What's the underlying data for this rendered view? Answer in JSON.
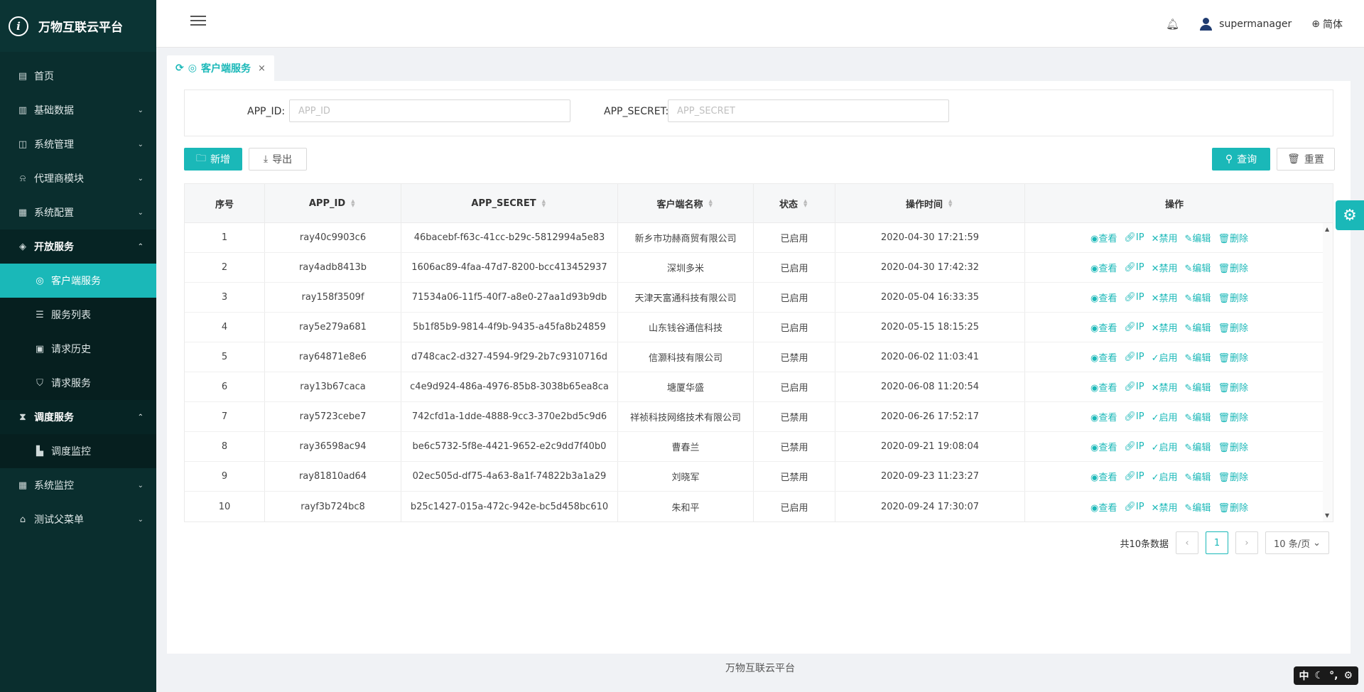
{
  "app": {
    "title": "万物互联云平台"
  },
  "sidebar": {
    "items": [
      {
        "icon": "calendar-icon",
        "glyph": "▤",
        "label": "首页"
      },
      {
        "icon": "barcode-icon",
        "glyph": "▥",
        "label": "基础数据",
        "arrow": "⌄"
      },
      {
        "icon": "camera-icon",
        "glyph": "◫",
        "label": "系统管理",
        "arrow": "⌄"
      },
      {
        "icon": "bell-icon",
        "glyph": "⍾",
        "label": "代理商模块",
        "arrow": "⌄"
      },
      {
        "icon": "config-icon",
        "glyph": "▦",
        "label": "系统配置",
        "arrow": "⌄"
      },
      {
        "icon": "tag-icon",
        "glyph": "◈",
        "label": "开放服务",
        "arrow": "⌃",
        "open": true,
        "children": [
          {
            "icon": "target-icon",
            "glyph": "◎",
            "label": "客户端服务",
            "active": true
          },
          {
            "icon": "list-icon",
            "glyph": "☰",
            "label": "服务列表"
          },
          {
            "icon": "archive-icon",
            "glyph": "▣",
            "label": "请求历史"
          },
          {
            "icon": "shield-icon",
            "glyph": "⛉",
            "label": "请求服务"
          }
        ]
      },
      {
        "icon": "hourglass-icon",
        "glyph": "⧗",
        "label": "调度服务",
        "arrow": "⌃",
        "open": true,
        "children": [
          {
            "icon": "chart-icon",
            "glyph": "▙",
            "label": "调度监控"
          }
        ]
      },
      {
        "icon": "monitor-icon",
        "glyph": "▦",
        "label": "系统监控",
        "arrow": "⌄"
      },
      {
        "icon": "bank-icon",
        "glyph": "⌂",
        "label": "测试父菜单",
        "arrow": "⌄"
      }
    ]
  },
  "header": {
    "username": "supermanager",
    "language": "简体"
  },
  "tabs": [
    {
      "label": "客户端服务",
      "close": "×"
    }
  ],
  "search": {
    "app_id_label": "APP_ID:",
    "app_id_placeholder": "APP_ID",
    "app_id_value": "",
    "app_secret_label": "APP_SECRET:",
    "app_secret_placeholder": "APP_SECRET",
    "app_secret_value": ""
  },
  "toolbar": {
    "add_label": "新增",
    "export_label": "导出",
    "query_label": "查询",
    "reset_label": "重置"
  },
  "table": {
    "columns": [
      "序号",
      "APP_ID",
      "APP_SECRET",
      "客户端名称",
      "状态",
      "操作时间",
      "操作"
    ],
    "rows": [
      {
        "no": "1",
        "app_id": "ray40c9903c6",
        "secret": "46bacebf-f63c-41cc-b29c-5812994a5e83",
        "name": "新乡市功赫商贸有限公司",
        "status": "已启用",
        "time": "2020-04-30 17:21:59",
        "toggle": "禁用"
      },
      {
        "no": "2",
        "app_id": "ray4adb8413b",
        "secret": "1606ac89-4faa-47d7-8200-bcc413452937",
        "name": "深圳多米",
        "status": "已启用",
        "time": "2020-04-30 17:42:32",
        "toggle": "禁用"
      },
      {
        "no": "3",
        "app_id": "ray158f3509f",
        "secret": "71534a06-11f5-40f7-a8e0-27aa1d93b9db",
        "name": "天津天富通科技有限公司",
        "status": "已启用",
        "time": "2020-05-04 16:33:35",
        "toggle": "禁用"
      },
      {
        "no": "4",
        "app_id": "ray5e279a681",
        "secret": "5b1f85b9-9814-4f9b-9435-a45fa8b24859",
        "name": "山东钱谷通信科技",
        "status": "已启用",
        "time": "2020-05-15 18:15:25",
        "toggle": "禁用"
      },
      {
        "no": "5",
        "app_id": "ray64871e8e6",
        "secret": "d748cac2-d327-4594-9f29-2b7c9310716d",
        "name": "信灏科技有限公司",
        "status": "已禁用",
        "time": "2020-06-02 11:03:41",
        "toggle": "启用"
      },
      {
        "no": "6",
        "app_id": "ray13b67caca",
        "secret": "c4e9d924-486a-4976-85b8-3038b65ea8ca",
        "name": "塘厦华盛",
        "status": "已启用",
        "time": "2020-06-08 11:20:54",
        "toggle": "禁用"
      },
      {
        "no": "7",
        "app_id": "ray5723cebe7",
        "secret": "742cfd1a-1dde-4888-9cc3-370e2bd5c9d6",
        "name": "祥祯科技网络技术有限公司",
        "status": "已禁用",
        "time": "2020-06-26 17:52:17",
        "toggle": "启用"
      },
      {
        "no": "8",
        "app_id": "ray36598ac94",
        "secret": "be6c5732-5f8e-4421-9652-e2c9dd7f40b0",
        "name": "曹春兰",
        "status": "已禁用",
        "time": "2020-09-21 19:08:04",
        "toggle": "启用"
      },
      {
        "no": "9",
        "app_id": "ray81810ad64",
        "secret": "02ec505d-df75-4a63-8a1f-74822b3a1a29",
        "name": "刘晓军",
        "status": "已禁用",
        "time": "2020-09-23 11:23:27",
        "toggle": "启用"
      },
      {
        "no": "10",
        "app_id": "rayf3b724bc8",
        "secret": "b25c1427-015a-472c-942e-bc5d458bc610",
        "name": "朱和平",
        "status": "已启用",
        "time": "2020-09-24 17:30:07",
        "toggle": "禁用"
      }
    ],
    "actions": {
      "view": "查看",
      "ip": "IP",
      "edit": "编辑",
      "delete": "删除"
    }
  },
  "pagination": {
    "total_text": "共10条数据",
    "current_page": "1",
    "page_size": "10 条/页"
  },
  "footer": {
    "text": "万物互联云平台"
  },
  "ime": {
    "mode": "中"
  },
  "colors": {
    "accent": "#1ab8b8",
    "sidebar_bg": "#0a2e2e"
  }
}
